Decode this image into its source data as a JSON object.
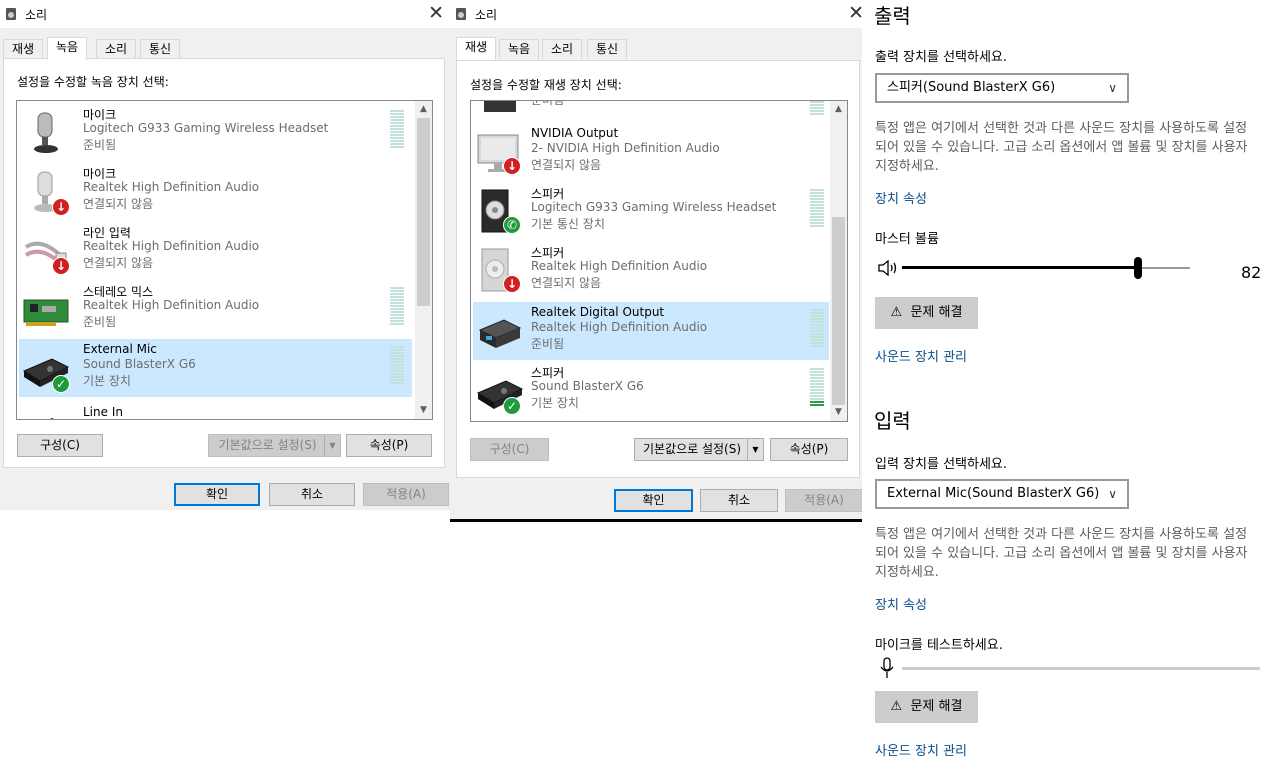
{
  "rec_dialog": {
    "title": "소리",
    "tabs": [
      "재생",
      "녹음",
      "소리",
      "통신"
    ],
    "active_tab": 1,
    "prompt": "설정을 수정할 녹음 장치 선택:",
    "devices": [
      {
        "name": "마이크",
        "line1": "Logitech G933 Gaming Wireless Headset",
        "line2": "준비됨",
        "icon": "microphone-icon",
        "status": "ready"
      },
      {
        "name": "마이크",
        "line1": "Realtek High Definition Audio",
        "line2": "연결되지 않음",
        "icon": "microphone-icon",
        "status": "disconnected"
      },
      {
        "name": "라인 입력",
        "line1": "Realtek High Definition Audio",
        "line2": "연결되지 않음",
        "icon": "line-in-cable-icon",
        "status": "disconnected"
      },
      {
        "name": "스테레오 믹스",
        "line1": "Realtek High Definition Audio",
        "line2": "준비됨",
        "icon": "sound-card-icon",
        "status": "ready"
      },
      {
        "name": "External Mic",
        "line1": "Sound BlasterX G6",
        "line2": "기본 장치",
        "icon": "sound-blaster-icon",
        "status": "default"
      },
      {
        "name": "Line In",
        "line1": "",
        "line2": "",
        "icon": "sound-blaster-icon",
        "status": "none"
      }
    ],
    "buttons": {
      "configure": "구성(C)",
      "set_default": "기본값으로 설정(S)",
      "properties": "속성(P)"
    },
    "footer": {
      "ok": "확인",
      "cancel": "취소",
      "apply": "적용(A)"
    }
  },
  "play_dialog": {
    "title": "소리",
    "tabs": [
      "재생",
      "녹음",
      "소리",
      "통신"
    ],
    "active_tab": 0,
    "prompt": "설정을 수정할 재생 장치 선택:",
    "devices": [
      {
        "name": "",
        "line1": "",
        "line2": "준비됨",
        "icon": "speaker-icon",
        "status": "ready"
      },
      {
        "name": "NVIDIA Output",
        "line1": "2- NVIDIA High Definition Audio",
        "line2": "연결되지 않음",
        "icon": "monitor-icon",
        "status": "disconnected"
      },
      {
        "name": "스피커",
        "line1": "Logitech G933 Gaming Wireless Headset",
        "line2": "기본 통신 장치",
        "icon": "speaker-icon",
        "status": "comm"
      },
      {
        "name": "스피커",
        "line1": "Realtek High Definition Audio",
        "line2": "연결되지 않음",
        "icon": "speaker-icon",
        "status": "disconnected"
      },
      {
        "name": "Realtek Digital Output",
        "line1": "Realtek High Definition Audio",
        "line2": "준비됨",
        "icon": "digital-output-icon",
        "status": "ready"
      },
      {
        "name": "스피커",
        "line1": "Sound BlasterX G6",
        "line2": "기본 장치",
        "icon": "sound-blaster-icon",
        "status": "default"
      }
    ],
    "buttons": {
      "configure": "구성(C)",
      "set_default": "기본값으로 설정(S)",
      "properties": "속성(P)"
    },
    "footer": {
      "ok": "확인",
      "cancel": "취소",
      "apply": "적용(A)"
    }
  },
  "settings": {
    "output": {
      "heading": "출력",
      "choose_label": "출력 장치를 선택하세요.",
      "selected_device": "스피커(Sound BlasterX G6)",
      "help_line1": "특정 앱은 여기에서 선택한 것과 다른 사운드 장치를 사용하도록 설정",
      "help_line2": "되어 있을 수 있습니다. 고급 소리 옵션에서 앱 볼륨 및 장치를 사용자",
      "help_line3": "지정하세요.",
      "device_properties": "장치 속성",
      "master_volume_label": "마스터 볼륨",
      "master_volume_value": "82",
      "master_volume_level": 0.82,
      "troubleshoot": "문제 해결",
      "manage_devices": "사운드 장치 관리"
    },
    "input": {
      "heading": "입력",
      "choose_label": "입력 장치를 선택하세요.",
      "selected_device": "External Mic(Sound BlasterX G6)",
      "help_line1": "특정 앱은 여기에서 선택한 것과 다른 사운드 장치를 사용하도록 설정",
      "help_line2": "되어 있을 수 있습니다. 고급 소리 옵션에서 앱 볼륨 및 장치를 사용자",
      "help_line3": "지정하세요.",
      "device_properties": "장치 속성",
      "mic_test_label": "마이크를 테스트하세요.",
      "troubleshoot": "문제 해결",
      "manage_devices": "사운드 장치 관리"
    }
  }
}
